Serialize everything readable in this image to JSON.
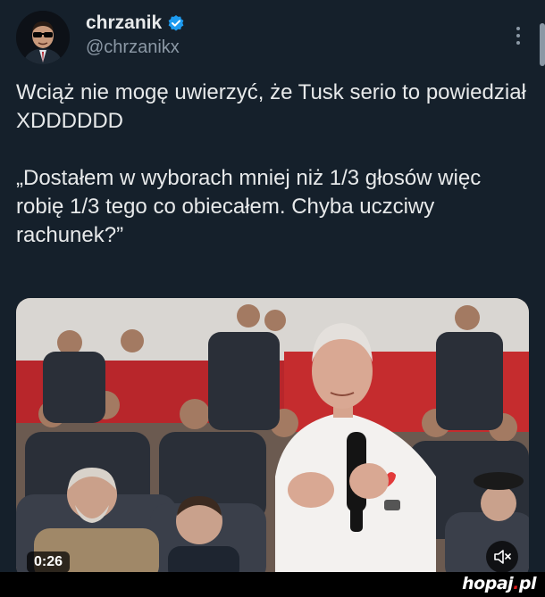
{
  "author": {
    "display_name": "chrzanik",
    "handle": "@chrzanikx",
    "verified": true,
    "verified_color": "#1d9bf0"
  },
  "tweet": {
    "paragraph_1": "Wciąż nie mogę uwierzyć, że Tusk serio to powiedział XDDDDDD",
    "paragraph_2": "„Dostałem w wyborach mniej niż 1/3 głosów więc robię 1/3 tego co obiecałem. Chyba uczciwy rachunek?”"
  },
  "media": {
    "duration": "0:26",
    "muted": true
  },
  "watermark": {
    "text_main": "hopaj",
    "text_dot": ".",
    "text_tld": "pl"
  },
  "icons": {
    "avatar": "avatar-sunglasses-icon",
    "verified": "verified-badge-icon",
    "more": "more-options-icon",
    "mute": "volume-muted-icon"
  },
  "colors": {
    "background": "#15202b",
    "text": "#e7e9ea",
    "secondary_text": "#8b98a5",
    "accent": "#1d9bf0"
  }
}
